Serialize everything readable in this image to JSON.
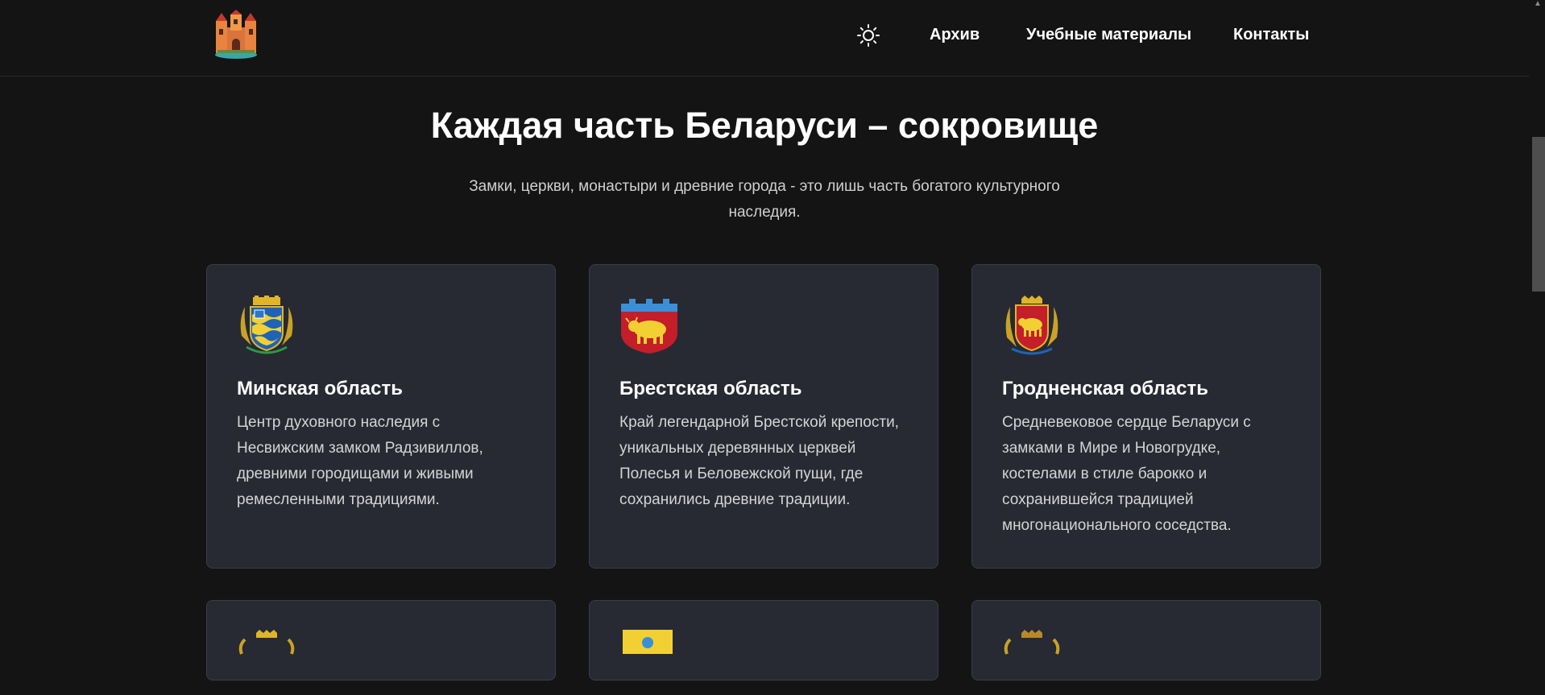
{
  "header": {
    "logo_icon": "castle-logo-icon",
    "theme_icon": "sun-icon",
    "nav": {
      "archive": "Архив",
      "materials": "Учебные материалы",
      "contacts": "Контакты"
    }
  },
  "hero": {
    "title": "Каждая часть Беларуси – сокровище",
    "subtitle": "Замки, церкви, монастыри и древние города - это лишь часть богатого культурного наследия."
  },
  "regions": [
    {
      "title": "Минская область",
      "text": "Центр духовного наследия с Несвижским замком Радзивиллов, древними городищами и живыми ремесленными традициями.",
      "crest_icon": "minsk-region-coat-of-arms-icon"
    },
    {
      "title": "Брестская область",
      "text": "Край легендарной Брестской крепости, уникальных деревянных церквей Полесья и Беловежской пущи, где сохранились древние традиции.",
      "crest_icon": "brest-region-coat-of-arms-icon"
    },
    {
      "title": "Гродненская область",
      "text": "Средневековое сердце Беларуси с замками в Мире и Новогрудке, костелами в стиле барокко и сохранившейся традицией многонационального соседства.",
      "crest_icon": "grodno-region-coat-of-arms-icon"
    }
  ],
  "colors": {
    "background": "#141414",
    "card_background": "#272a32",
    "card_border": "#3a3d45",
    "text_primary": "#ffffff",
    "text_secondary": "#d4d4d4"
  }
}
